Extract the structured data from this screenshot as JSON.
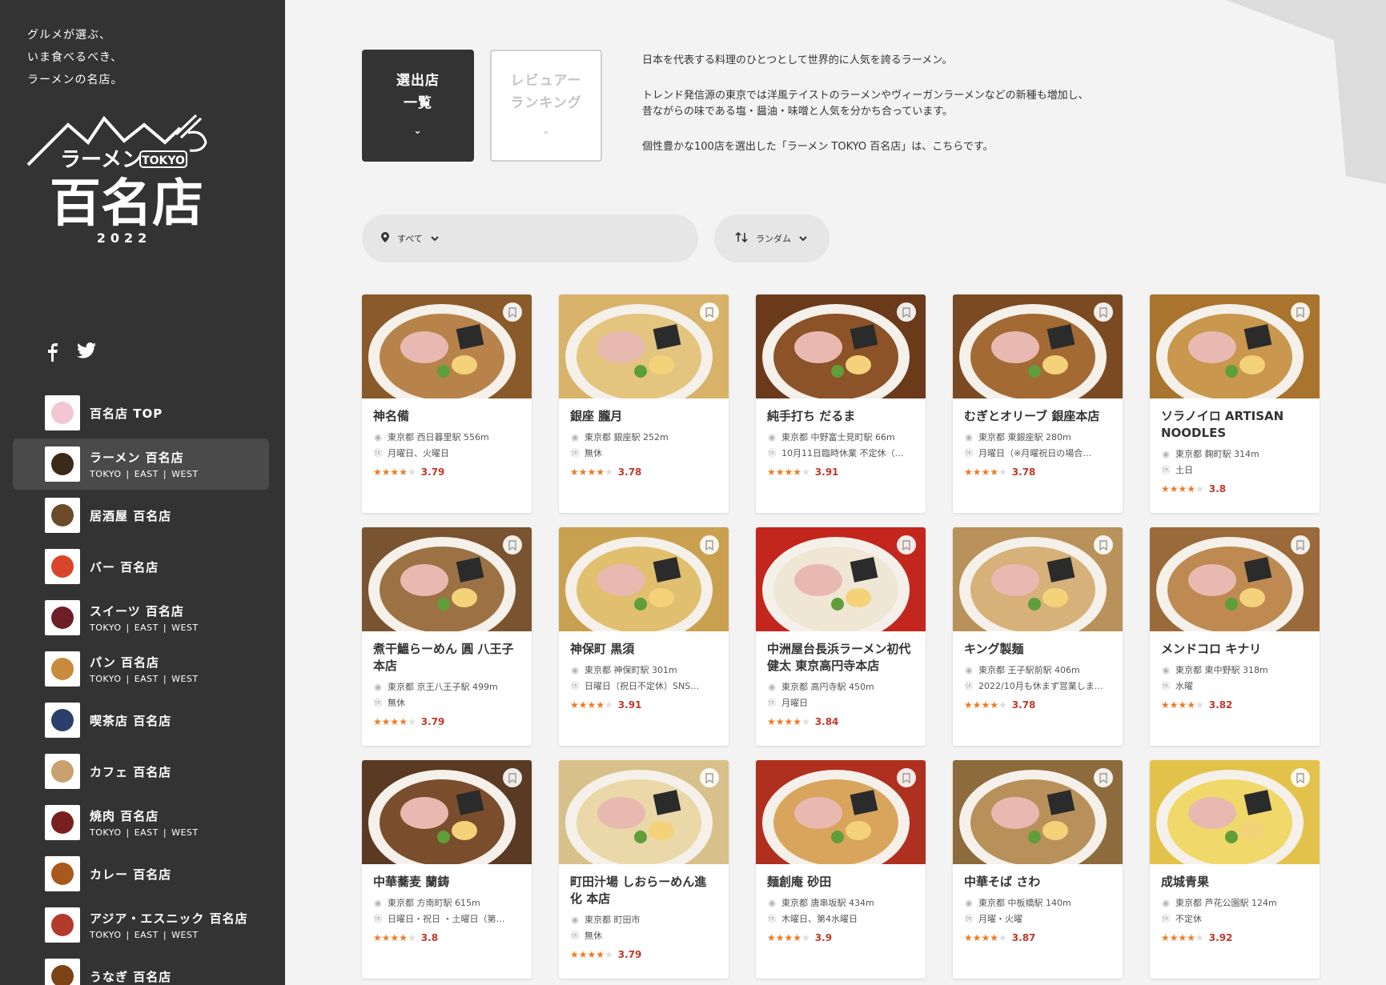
{
  "sidebar": {
    "tagline": [
      "グルメが選ぶ、",
      "いま食べるべき、",
      "ラーメンの名店。"
    ],
    "logo": {
      "title_main": "ラーメン",
      "title_badge": "TOKYO",
      "title_big": "百名店",
      "year": "2022"
    },
    "social": [
      "facebook-icon",
      "twitter-icon"
    ],
    "nav": [
      {
        "label": "百名店 TOP",
        "sub": [],
        "color": "#f2c7d3"
      },
      {
        "label": "ラーメン 百名店",
        "sub": [
          "TOKYO",
          "EAST",
          "WEST"
        ],
        "color": "#3b2a1a",
        "active": true
      },
      {
        "label": "居酒屋 百名店",
        "sub": [],
        "color": "#6b4b2a"
      },
      {
        "label": "バー 百名店",
        "sub": [],
        "color": "#d9452b"
      },
      {
        "label": "スイーツ 百名店",
        "sub": [
          "TOKYO",
          "EAST",
          "WEST"
        ],
        "color": "#6e1f26"
      },
      {
        "label": "パン 百名店",
        "sub": [
          "TOKYO",
          "EAST",
          "WEST"
        ],
        "color": "#c98a3d"
      },
      {
        "label": "喫茶店 百名店",
        "sub": [],
        "color": "#2c3e6b"
      },
      {
        "label": "カフェ 百名店",
        "sub": [],
        "color": "#c9a070"
      },
      {
        "label": "焼肉 百名店",
        "sub": [
          "TOKYO",
          "EAST",
          "WEST"
        ],
        "color": "#7a1f1f"
      },
      {
        "label": "カレー 百名店",
        "sub": [],
        "color": "#a8591b"
      },
      {
        "label": "アジア・エスニック 百名店",
        "sub": [
          "TOKYO",
          "EAST",
          "WEST"
        ],
        "color": "#b33a2c"
      },
      {
        "label": "うなぎ 百名店",
        "sub": [],
        "color": "#7b4316"
      }
    ]
  },
  "main": {
    "mode_buttons": [
      {
        "line1": "選出店",
        "line2": "一覧",
        "chevron": "⌄"
      },
      {
        "line1": "レビュアー",
        "line2": "ランキング",
        "chevron": "⌄"
      }
    ],
    "intro": [
      "日本を代表する料理のひとつとして世界的に人気を誇るラーメン。",
      "トレンド発信源の東京では洋風テイストのラーメンやヴィーガンラーメンなどの新種も増加し、昔ながらの味である塩・醤油・味噌と人気を分かち合っています。",
      "個性豊かな100店を選出した「ラーメン TOKYO 百名店」は、こちらです。"
    ],
    "filters": {
      "area": {
        "icon": "location-pin-icon",
        "label": "すべて"
      },
      "sort": {
        "icon": "sort-icon",
        "label": "ランダム"
      }
    },
    "shops": [
      {
        "name": "神名備",
        "location": "東京都 西日暮里駅 556m",
        "holiday": "月曜日、火曜日",
        "rating": "3.79",
        "stars": 4,
        "bowl": "#8a5a2b",
        "broth": "#b8834a"
      },
      {
        "name": "銀座 朧月",
        "location": "東京都 銀座駅 252m",
        "holiday": "無休",
        "rating": "3.78",
        "stars": 4,
        "bowl": "#d9b26a",
        "broth": "#e3c57f"
      },
      {
        "name": "純手打ち だるま",
        "location": "東京都 中野富士見町駅 66m",
        "holiday": "10月11日臨時休業 不定休（…",
        "rating": "3.91",
        "stars": 4,
        "bowl": "#6b3a1a",
        "broth": "#8c5228"
      },
      {
        "name": "むぎとオリーブ 銀座本店",
        "location": "東京都 東銀座駅 280m",
        "holiday": "月曜日（※月曜祝日の場合…",
        "rating": "3.78",
        "stars": 4,
        "bowl": "#7b4a22",
        "broth": "#a36a33"
      },
      {
        "name": "ソラノイロ ARTISAN NOODLES",
        "location": "東京都 麹町駅 314m",
        "holiday": "土日",
        "rating": "3.8",
        "stars": 4,
        "bowl": "#a8742e",
        "broth": "#c9974d"
      },
      {
        "name": "煮干鰮らーめん 圓 八王子本店",
        "location": "東京都 京王八王子駅 499m",
        "holiday": "無休",
        "rating": "3.79",
        "stars": 4,
        "bowl": "#7a5430",
        "broth": "#9c7245"
      },
      {
        "name": "神保町 黒須",
        "location": "東京都 神保町駅 301m",
        "holiday": "日曜日（祝日不定休）SNS…",
        "rating": "3.91",
        "stars": 4,
        "bowl": "#c9a050",
        "broth": "#e0bf6e"
      },
      {
        "name": "中洲屋台長浜ラーメン初代 健太 東京高円寺本店",
        "location": "東京都 高円寺駅 450m",
        "holiday": "月曜日",
        "rating": "3.84",
        "stars": 4,
        "bowl": "#c2261d",
        "broth": "#efe6d4"
      },
      {
        "name": "キング製麺",
        "location": "東京都 王子駅前駅 406m",
        "holiday": "2022/10月も休まず営業しま…",
        "rating": "3.78",
        "stars": 4,
        "bowl": "#b8925a",
        "broth": "#d6b27a"
      },
      {
        "name": "メンドコロ キナリ",
        "location": "東京都 東中野駅 318m",
        "holiday": "水曜",
        "rating": "3.82",
        "stars": 4,
        "bowl": "#9a6a3a",
        "broth": "#be8a52"
      },
      {
        "name": "中華蕎麦 蘭鋳",
        "location": "東京都 方南町駅 615m",
        "holiday": "日曜日・祝日 ・土曜日（第…",
        "rating": "3.8",
        "stars": 4,
        "bowl": "#5a3a22",
        "broth": "#7a4e2c"
      },
      {
        "name": "町田汁場 しおらーめん進化 本店",
        "location": "東京都 町田市",
        "holiday": "無休",
        "rating": "3.79",
        "stars": 4,
        "bowl": "#d8c08a",
        "broth": "#ead8a8"
      },
      {
        "name": "麺創庵 砂田",
        "location": "東京都 唐串坂駅 434m",
        "holiday": "木曜日、第4水曜日",
        "rating": "3.9",
        "stars": 4,
        "bowl": "#b0301f",
        "broth": "#d9a55c"
      },
      {
        "name": "中華そば さわ",
        "location": "東京都 中板橋駅 140m",
        "holiday": "月曜・火曜",
        "rating": "3.87",
        "stars": 4,
        "bowl": "#8e6b3c",
        "broth": "#b8915a"
      },
      {
        "name": "成城青果",
        "location": "東京都 芦花公園駅 124m",
        "holiday": "不定休",
        "rating": "3.92",
        "stars": 4,
        "bowl": "#e2c24a",
        "broth": "#f0d86a"
      }
    ]
  }
}
